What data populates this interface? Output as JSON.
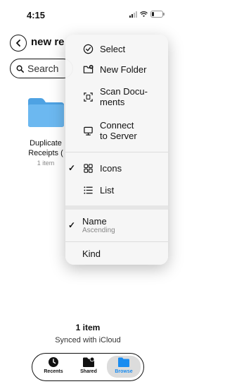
{
  "status_bar": {
    "time": "4:15"
  },
  "nav": {
    "title": "new re"
  },
  "search": {
    "placeholder": "Search"
  },
  "folder": {
    "name_line1": "Duplicate",
    "name_line2": "Receipts (",
    "count": "1 item"
  },
  "menu": {
    "items": [
      {
        "label": "Select",
        "icon": "checkmark-circle-icon"
      },
      {
        "label": "New Folder",
        "icon": "folder-plus-icon"
      },
      {
        "label": "Scan Documents",
        "label_line1": "Scan Docu-",
        "label_line2": "ments",
        "icon": "document-scan-icon"
      },
      {
        "label": "Connect to Server",
        "label_line1": "Connect",
        "label_line2": "to Server",
        "icon": "monitor-icon"
      },
      {
        "label": "Icons",
        "icon": "grid-icon",
        "checked": true
      },
      {
        "label": "List",
        "icon": "list-icon",
        "checked": false
      },
      {
        "label": "Name",
        "sublabel": "Ascending",
        "checked": true
      },
      {
        "label": "Kind",
        "checked": false
      }
    ],
    "checkmark": "✓"
  },
  "footer": {
    "item_count": "1 item",
    "sync_status": "Synced with iCloud"
  },
  "tabs": [
    {
      "label": "Recents",
      "icon": "clock-icon",
      "active": false
    },
    {
      "label": "Shared",
      "icon": "shared-folder-icon",
      "active": false
    },
    {
      "label": "Browse",
      "icon": "folder-icon",
      "active": true
    }
  ],
  "colors": {
    "accent": "#1a8cf0",
    "folder": "#5aaee8"
  }
}
